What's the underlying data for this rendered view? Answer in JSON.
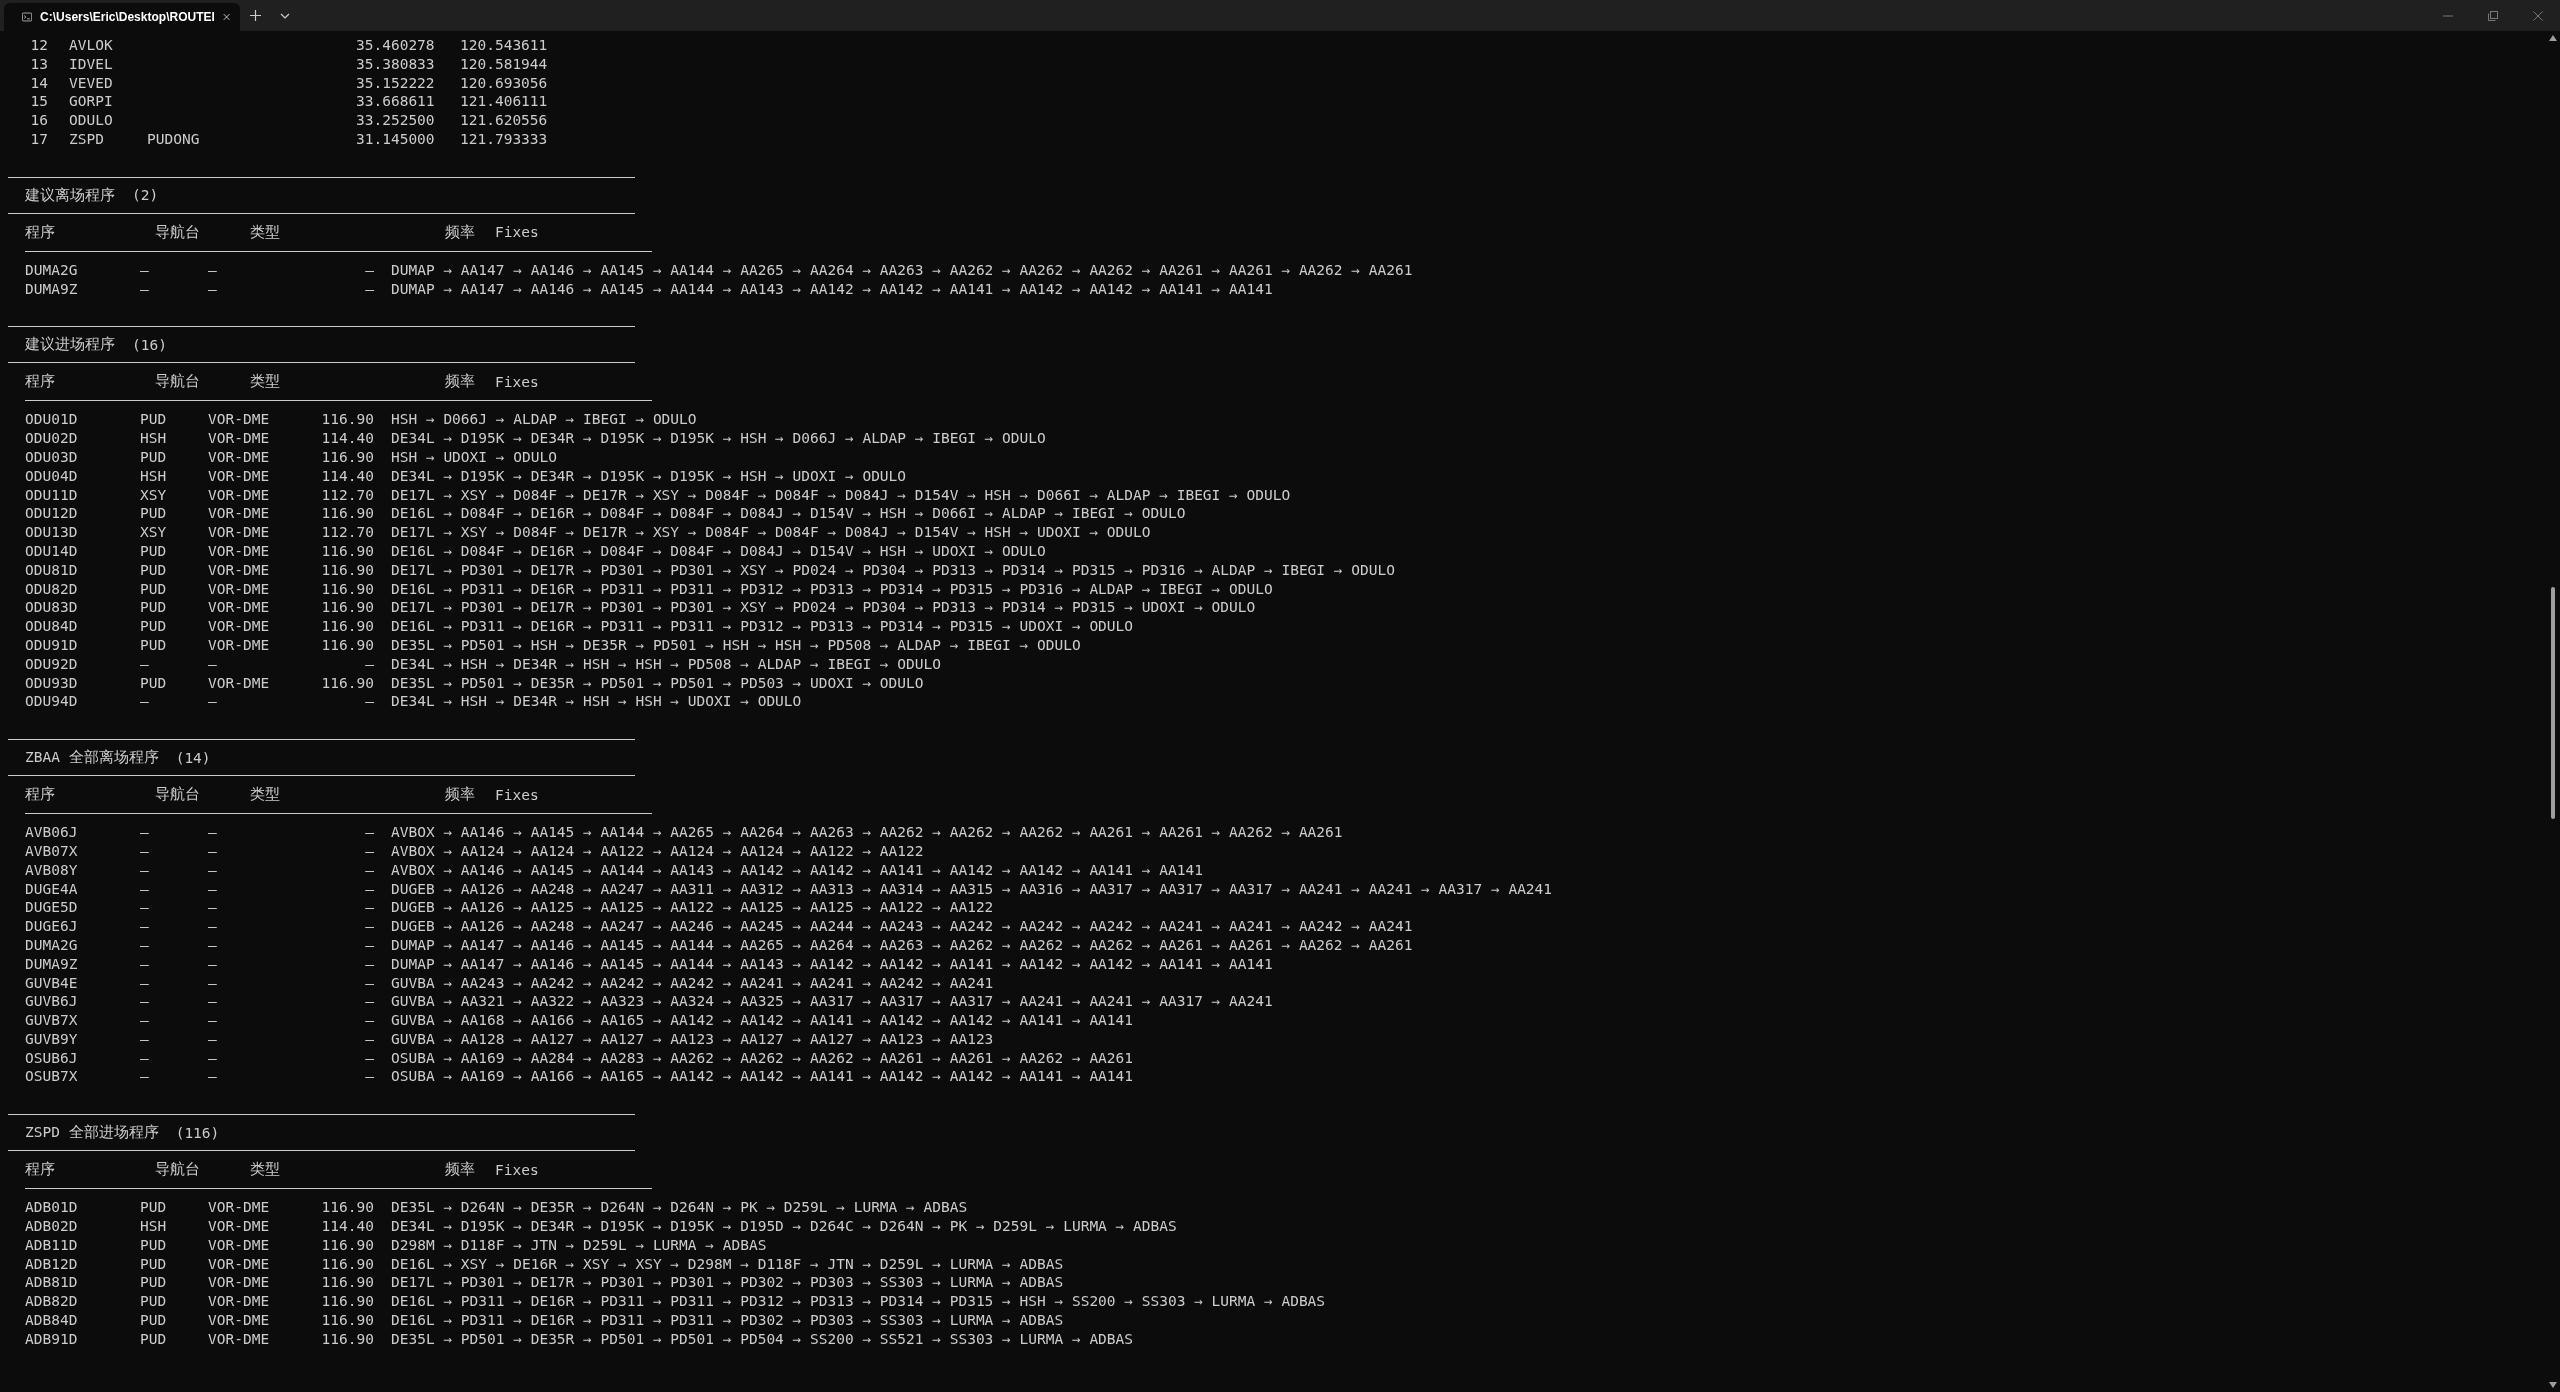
{
  "tab": {
    "title": "C:\\Users\\Eric\\Desktop\\ROUTEI"
  },
  "waypoints": [
    {
      "index": "12",
      "ident": "AVLOK",
      "lat": "35.460278",
      "lon": "120.543611"
    },
    {
      "index": "13",
      "ident": "IDVEL",
      "lat": "35.380833",
      "lon": "120.581944"
    },
    {
      "index": "14",
      "ident": "VEVED",
      "lat": "35.152222",
      "lon": "120.693056"
    },
    {
      "index": "15",
      "ident": "GORPI",
      "lat": "33.668611",
      "lon": "121.406111"
    },
    {
      "index": "16",
      "ident": "ODULO",
      "lat": "33.252500",
      "lon": "121.620556"
    },
    {
      "index": "17",
      "ident": "ZSPD",
      "name": "PUDONG",
      "lat": "31.145000",
      "lon": "121.793333"
    }
  ],
  "sections": [
    {
      "title": "建议离场程序",
      "count": "(2)",
      "columns": [
        "程序",
        "导航台",
        "类型",
        "频率",
        "Fixes"
      ],
      "rows": [
        {
          "procedure": "DUMA2G",
          "navaid": "–",
          "type": "–",
          "frequency": "–",
          "fixes": "DUMAP → AA147 → AA146 → AA145 → AA144 → AA265 → AA264 → AA263 → AA262 → AA262 → AA262 → AA261 → AA261 → AA262 → AA261"
        },
        {
          "procedure": "DUMA9Z",
          "navaid": "–",
          "type": "–",
          "frequency": "–",
          "fixes": "DUMAP → AA147 → AA146 → AA145 → AA144 → AA143 → AA142 → AA142 → AA141 → AA142 → AA142 → AA141 → AA141"
        }
      ]
    },
    {
      "title": "建议进场程序",
      "count": "(16)",
      "columns": [
        "程序",
        "导航台",
        "类型",
        "频率",
        "Fixes"
      ],
      "rows": [
        {
          "procedure": "ODU01D",
          "navaid": "PUD",
          "type": "VOR-DME",
          "frequency": "116.90",
          "fixes": "HSH → D066J → ALDAP → IBEGI → ODULO"
        },
        {
          "procedure": "ODU02D",
          "navaid": "HSH",
          "type": "VOR-DME",
          "frequency": "114.40",
          "fixes": "DE34L → D195K → DE34R → D195K → D195K → HSH → D066J → ALDAP → IBEGI → ODULO"
        },
        {
          "procedure": "ODU03D",
          "navaid": "PUD",
          "type": "VOR-DME",
          "frequency": "116.90",
          "fixes": "HSH → UDOXI → ODULO"
        },
        {
          "procedure": "ODU04D",
          "navaid": "HSH",
          "type": "VOR-DME",
          "frequency": "114.40",
          "fixes": "DE34L → D195K → DE34R → D195K → D195K → HSH → UDOXI → ODULO"
        },
        {
          "procedure": "ODU11D",
          "navaid": "XSY",
          "type": "VOR-DME",
          "frequency": "112.70",
          "fixes": "DE17L → XSY → D084F → DE17R → XSY → D084F → D084F → D084J → D154V → HSH → D066I → ALDAP → IBEGI → ODULO"
        },
        {
          "procedure": "ODU12D",
          "navaid": "PUD",
          "type": "VOR-DME",
          "frequency": "116.90",
          "fixes": "DE16L → D084F → DE16R → D084F → D084F → D084J → D154V → HSH → D066I → ALDAP → IBEGI → ODULO"
        },
        {
          "procedure": "ODU13D",
          "navaid": "XSY",
          "type": "VOR-DME",
          "frequency": "112.70",
          "fixes": "DE17L → XSY → D084F → DE17R → XSY → D084F → D084F → D084J → D154V → HSH → UDOXI → ODULO"
        },
        {
          "procedure": "ODU14D",
          "navaid": "PUD",
          "type": "VOR-DME",
          "frequency": "116.90",
          "fixes": "DE16L → D084F → DE16R → D084F → D084F → D084J → D154V → HSH → UDOXI → ODULO"
        },
        {
          "procedure": "ODU81D",
          "navaid": "PUD",
          "type": "VOR-DME",
          "frequency": "116.90",
          "fixes": "DE17L → PD301 → DE17R → PD301 → PD301 → XSY → PD024 → PD304 → PD313 → PD314 → PD315 → PD316 → ALDAP → IBEGI → ODULO"
        },
        {
          "procedure": "ODU82D",
          "navaid": "PUD",
          "type": "VOR-DME",
          "frequency": "116.90",
          "fixes": "DE16L → PD311 → DE16R → PD311 → PD311 → PD312 → PD313 → PD314 → PD315 → PD316 → ALDAP → IBEGI → ODULO"
        },
        {
          "procedure": "ODU83D",
          "navaid": "PUD",
          "type": "VOR-DME",
          "frequency": "116.90",
          "fixes": "DE17L → PD301 → DE17R → PD301 → PD301 → XSY → PD024 → PD304 → PD313 → PD314 → PD315 → UDOXI → ODULO"
        },
        {
          "procedure": "ODU84D",
          "navaid": "PUD",
          "type": "VOR-DME",
          "frequency": "116.90",
          "fixes": "DE16L → PD311 → DE16R → PD311 → PD311 → PD312 → PD313 → PD314 → PD315 → UDOXI → ODULO"
        },
        {
          "procedure": "ODU91D",
          "navaid": "PUD",
          "type": "VOR-DME",
          "frequency": "116.90",
          "fixes": "DE35L → PD501 → HSH → DE35R → PD501 → HSH → HSH → PD508 → ALDAP → IBEGI → ODULO"
        },
        {
          "procedure": "ODU92D",
          "navaid": "–",
          "type": "–",
          "frequency": "–",
          "fixes": "DE34L → HSH → DE34R → HSH → HSH → PD508 → ALDAP → IBEGI → ODULO"
        },
        {
          "procedure": "ODU93D",
          "navaid": "PUD",
          "type": "VOR-DME",
          "frequency": "116.90",
          "fixes": "DE35L → PD501 → DE35R → PD501 → PD501 → PD503 → UDOXI → ODULO"
        },
        {
          "procedure": "ODU94D",
          "navaid": "–",
          "type": "–",
          "frequency": "–",
          "fixes": "DE34L → HSH → DE34R → HSH → HSH → UDOXI → ODULO"
        }
      ]
    },
    {
      "title": "ZBAA 全部离场程序",
      "count": "(14)",
      "columns": [
        "程序",
        "导航台",
        "类型",
        "频率",
        "Fixes"
      ],
      "rows": [
        {
          "procedure": "AVB06J",
          "navaid": "–",
          "type": "–",
          "frequency": "–",
          "fixes": "AVBOX → AA146 → AA145 → AA144 → AA265 → AA264 → AA263 → AA262 → AA262 → AA262 → AA261 → AA261 → AA262 → AA261"
        },
        {
          "procedure": "AVB07X",
          "navaid": "–",
          "type": "–",
          "frequency": "–",
          "fixes": "AVBOX → AA124 → AA124 → AA122 → AA124 → AA124 → AA122 → AA122"
        },
        {
          "procedure": "AVB08Y",
          "navaid": "–",
          "type": "–",
          "frequency": "–",
          "fixes": "AVBOX → AA146 → AA145 → AA144 → AA143 → AA142 → AA142 → AA141 → AA142 → AA142 → AA141 → AA141"
        },
        {
          "procedure": "DUGE4A",
          "navaid": "–",
          "type": "–",
          "frequency": "–",
          "fixes": "DUGEB → AA126 → AA248 → AA247 → AA311 → AA312 → AA313 → AA314 → AA315 → AA316 → AA317 → AA317 → AA317 → AA241 → AA241 → AA317 → AA241"
        },
        {
          "procedure": "DUGE5D",
          "navaid": "–",
          "type": "–",
          "frequency": "–",
          "fixes": "DUGEB → AA126 → AA125 → AA125 → AA122 → AA125 → AA125 → AA122 → AA122"
        },
        {
          "procedure": "DUGE6J",
          "navaid": "–",
          "type": "–",
          "frequency": "–",
          "fixes": "DUGEB → AA126 → AA248 → AA247 → AA246 → AA245 → AA244 → AA243 → AA242 → AA242 → AA242 → AA241 → AA241 → AA242 → AA241"
        },
        {
          "procedure": "DUMA2G",
          "navaid": "–",
          "type": "–",
          "frequency": "–",
          "fixes": "DUMAP → AA147 → AA146 → AA145 → AA144 → AA265 → AA264 → AA263 → AA262 → AA262 → AA262 → AA261 → AA261 → AA262 → AA261"
        },
        {
          "procedure": "DUMA9Z",
          "navaid": "–",
          "type": "–",
          "frequency": "–",
          "fixes": "DUMAP → AA147 → AA146 → AA145 → AA144 → AA143 → AA142 → AA142 → AA141 → AA142 → AA142 → AA141 → AA141"
        },
        {
          "procedure": "GUVB4E",
          "navaid": "–",
          "type": "–",
          "frequency": "–",
          "fixes": "GUVBA → AA243 → AA242 → AA242 → AA242 → AA241 → AA241 → AA242 → AA241"
        },
        {
          "procedure": "GUVB6J",
          "navaid": "–",
          "type": "–",
          "frequency": "–",
          "fixes": "GUVBA → AA321 → AA322 → AA323 → AA324 → AA325 → AA317 → AA317 → AA317 → AA241 → AA241 → AA317 → AA241"
        },
        {
          "procedure": "GUVB7X",
          "navaid": "–",
          "type": "–",
          "frequency": "–",
          "fixes": "GUVBA → AA168 → AA166 → AA165 → AA142 → AA142 → AA141 → AA142 → AA142 → AA141 → AA141"
        },
        {
          "procedure": "GUVB9Y",
          "navaid": "–",
          "type": "–",
          "frequency": "–",
          "fixes": "GUVBA → AA128 → AA127 → AA127 → AA123 → AA127 → AA127 → AA123 → AA123"
        },
        {
          "procedure": "OSUB6J",
          "navaid": "–",
          "type": "–",
          "frequency": "–",
          "fixes": "OSUBA → AA169 → AA284 → AA283 → AA262 → AA262 → AA262 → AA261 → AA261 → AA262 → AA261"
        },
        {
          "procedure": "OSUB7X",
          "navaid": "–",
          "type": "–",
          "frequency": "–",
          "fixes": "OSUBA → AA169 → AA166 → AA165 → AA142 → AA142 → AA141 → AA142 → AA142 → AA141 → AA141"
        }
      ]
    },
    {
      "title": "ZSPD 全部进场程序",
      "count": "(116)",
      "columns": [
        "程序",
        "导航台",
        "类型",
        "频率",
        "Fixes"
      ],
      "rows": [
        {
          "procedure": "ADB01D",
          "navaid": "PUD",
          "type": "VOR-DME",
          "frequency": "116.90",
          "fixes": "DE35L → D264N → DE35R → D264N → D264N → PK → D259L → LURMA → ADBAS"
        },
        {
          "procedure": "ADB02D",
          "navaid": "HSH",
          "type": "VOR-DME",
          "frequency": "114.40",
          "fixes": "DE34L → D195K → DE34R → D195K → D195K → D195D → D264C → D264N → PK → D259L → LURMA → ADBAS"
        },
        {
          "procedure": "ADB11D",
          "navaid": "PUD",
          "type": "VOR-DME",
          "frequency": "116.90",
          "fixes": "D298M → D118F → JTN → D259L → LURMA → ADBAS"
        },
        {
          "procedure": "ADB12D",
          "navaid": "PUD",
          "type": "VOR-DME",
          "frequency": "116.90",
          "fixes": "DE16L → XSY → DE16R → XSY → XSY → D298M → D118F → JTN → D259L → LURMA → ADBAS"
        },
        {
          "procedure": "ADB81D",
          "navaid": "PUD",
          "type": "VOR-DME",
          "frequency": "116.90",
          "fixes": "DE17L → PD301 → DE17R → PD301 → PD301 → PD302 → PD303 → SS303 → LURMA → ADBAS"
        },
        {
          "procedure": "ADB82D",
          "navaid": "PUD",
          "type": "VOR-DME",
          "frequency": "116.90",
          "fixes": "DE16L → PD311 → DE16R → PD311 → PD311 → PD312 → PD313 → PD314 → PD315 → HSH → SS200 → SS303 → LURMA → ADBAS"
        },
        {
          "procedure": "ADB84D",
          "navaid": "PUD",
          "type": "VOR-DME",
          "frequency": "116.90",
          "fixes": "DE16L → PD311 → DE16R → PD311 → PD311 → PD302 → PD303 → SS303 → LURMA → ADBAS"
        },
        {
          "procedure": "ADB91D",
          "navaid": "PUD",
          "type": "VOR-DME",
          "frequency": "116.90",
          "fixes": "DE35L → PD501 → DE35R → PD501 → PD501 → PD504 → SS200 → SS521 → SS303 → LURMA → ADBAS"
        }
      ]
    }
  ]
}
